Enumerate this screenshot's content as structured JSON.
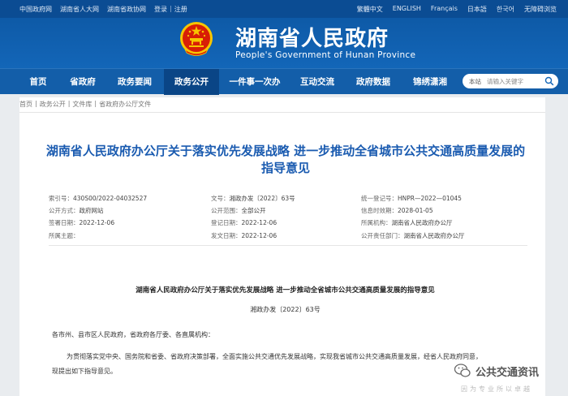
{
  "topbar": {
    "left_links": [
      "中国政府网",
      "湖南省人大网",
      "湖南省政协网"
    ],
    "login": "登录",
    "sep": "|",
    "register": "注册",
    "languages": [
      "繁體中文",
      "ENGLISH",
      "Français",
      "日本語",
      "한국어",
      "无障碍浏览"
    ]
  },
  "header": {
    "title_cn": "湖南省人民政府",
    "title_en": "People's Government of Hunan Province"
  },
  "nav": {
    "items": [
      "首页",
      "省政府",
      "政务要闻",
      "政务公开",
      "一件事一次办",
      "互动交流",
      "政府数据",
      "锦绣潇湘"
    ],
    "active": "政务公开"
  },
  "search": {
    "scope": "本站",
    "placeholder": "请输入关键字"
  },
  "breadcrumb": [
    "首页",
    "政务公开",
    "文件库",
    "省政府办公厅文件"
  ],
  "breadcrumb_sep": "|",
  "article": {
    "title": "湖南省人民政府办公厅关于落实优先发展战略 进一步推动全省城市公共交通高质量发展的指导意见"
  },
  "meta": [
    {
      "label": "索引号：",
      "value": "430S00/2022-04032527"
    },
    {
      "label": "文号：",
      "value": "湘政办发〔2022〕63号"
    },
    {
      "label": "统一登记号：",
      "value": "HNPR—2022—01045"
    },
    {
      "label": "公开方式：",
      "value": "政府网站"
    },
    {
      "label": "公开范围：",
      "value": "全部公开"
    },
    {
      "label": "信息时效期：",
      "value": "2028-01-05"
    },
    {
      "label": "签署日期：",
      "value": "2022-12-06"
    },
    {
      "label": "登记日期：",
      "value": "2022-12-06"
    },
    {
      "label": "所属机构：",
      "value": "湖南省人民政府办公厅"
    },
    {
      "label": "所属主题：",
      "value": ""
    },
    {
      "label": "发文日期：",
      "value": "2022-12-06"
    },
    {
      "label": "公开责任部门：",
      "value": "湖南省人民政府办公厅"
    }
  ],
  "body": {
    "doc_title": "湖南省人民政府办公厅关于落实优先发展战略  进一步推动全省城市公共交通高质量发展的指导意见",
    "doc_no": "湘政办发〔2022〕63号",
    "salutation": "各市州、县市区人民政府，省政府各厅委、各直属机构：",
    "para1_line1": "为贯彻落实党中央、国务院和省委、省政府决策部署，全面实施公共交通优先发展战略，实现我省城市公共交通高质量发展，经省人民政府同意，",
    "para1_line2": "现提出如下指导意见。"
  },
  "watermark": {
    "text": "公共交通资讯",
    "sub": "因为专业所以卓越"
  },
  "colors": {
    "brand_blue": "#135ea9",
    "dark_blue": "#0b4c93",
    "title_blue": "#1a5bb0",
    "emblem_red": "#d81e06",
    "emblem_gold": "#f7c600"
  }
}
